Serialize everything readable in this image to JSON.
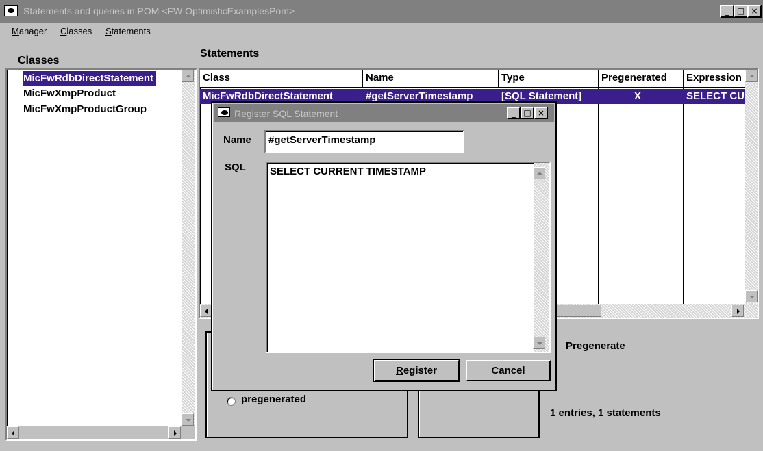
{
  "window": {
    "title": "Statements and queries in POM <FW OptimisticExamplesPom>",
    "controls": {
      "minimize": "_",
      "maximize": "□",
      "close": "×"
    }
  },
  "menu": [
    {
      "label": "Manager",
      "mnemonic": "M",
      "rest": "anager"
    },
    {
      "label": "Classes",
      "mnemonic": "C",
      "rest": "lasses"
    },
    {
      "label": "Statements",
      "mnemonic": "S",
      "rest": "tatements"
    }
  ],
  "classes": {
    "label": "Classes",
    "items": [
      {
        "label": "MicFwRdbDirectStatement",
        "selected": true
      },
      {
        "label": "MicFwXmpProduct",
        "selected": false
      },
      {
        "label": "MicFwXmpProductGroup",
        "selected": false
      }
    ]
  },
  "statements": {
    "label": "Statements",
    "columns": [
      "Class",
      "Name",
      "Type",
      "Pregenerated",
      "Expression"
    ],
    "rows": [
      {
        "class": "MicFwRdbDirectStatement",
        "name": "#getServerTimestamp",
        "type": "[SQL Statement]",
        "pregenerated": "X",
        "expression": "SELECT CU"
      }
    ]
  },
  "bottom": {
    "radio_label": "pregenerated",
    "checkbox_label": "Pregenerate",
    "checkbox_mnemonic": "P",
    "checkbox_rest": "regenerate",
    "status": "1 entries, 1 statements"
  },
  "dialog": {
    "title": "Register SQL Statement",
    "name_label": "Name",
    "name_value": "#getServerTimestamp",
    "sql_label": "SQL",
    "sql_value": "SELECT CURRENT TIMESTAMP",
    "register_label": "Register",
    "register_mnemonic": "R",
    "register_rest": "egister",
    "cancel_label": "Cancel"
  },
  "colors": {
    "selection": "#3a1e8c",
    "inactive_title": "#808080",
    "face": "#c0c0c0"
  }
}
